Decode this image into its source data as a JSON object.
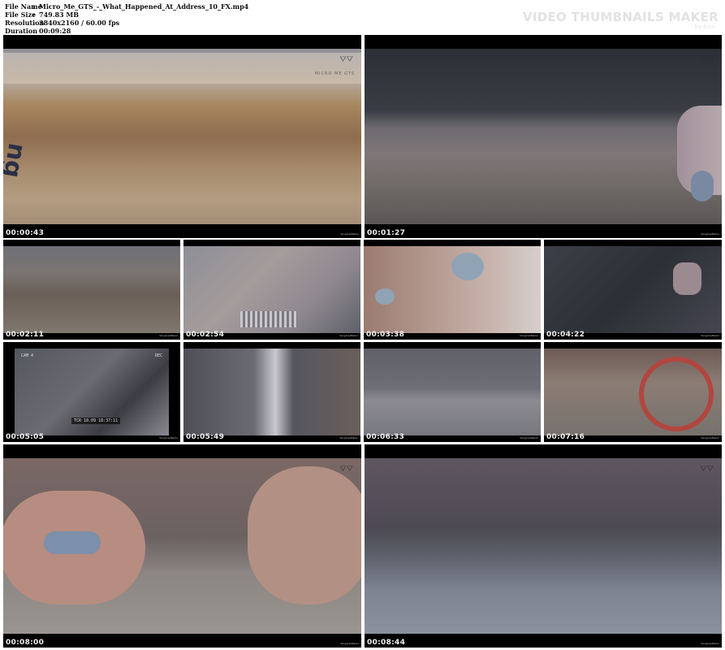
{
  "file_info": {
    "rows": [
      {
        "key": "File Name",
        "value": "Micro_Me_GTS_-_What_Happened_At_Address_10_FX.mp4"
      },
      {
        "key": "File Size",
        "value": "749.83 MB"
      },
      {
        "key": "Resolution",
        "value": "3840x2160 / 60.00 fps"
      },
      {
        "key": "Duration",
        "value": "00:09:28"
      }
    ],
    "separator": ":"
  },
  "watermark": {
    "title": "VIDEO THUMBNAILS MAKER",
    "byline": "by icon"
  },
  "thumbnails": [
    {
      "timestamp": "00:00:43",
      "logo_sub": "MICRO ME GTS"
    },
    {
      "timestamp": "00:01:27"
    },
    {
      "timestamp": "00:02:11"
    },
    {
      "timestamp": "00:02:54"
    },
    {
      "timestamp": "00:03:38"
    },
    {
      "timestamp": "00:04:22"
    },
    {
      "timestamp": "00:05:05",
      "cam_label": "CAM 4",
      "rec_label": "REC",
      "tc_label": "TCR 10.09 18:37:11"
    },
    {
      "timestamp": "00:05:49"
    },
    {
      "timestamp": "00:06:33"
    },
    {
      "timestamp": "00:07:16"
    },
    {
      "timestamp": "00:08:00"
    },
    {
      "timestamp": "00:08:44"
    }
  ],
  "frame_credit": "VenginesMaker",
  "colors": {
    "tile_border": "#000000",
    "timestamp": "#eeeeee",
    "watermark": "#e2e2e2"
  }
}
